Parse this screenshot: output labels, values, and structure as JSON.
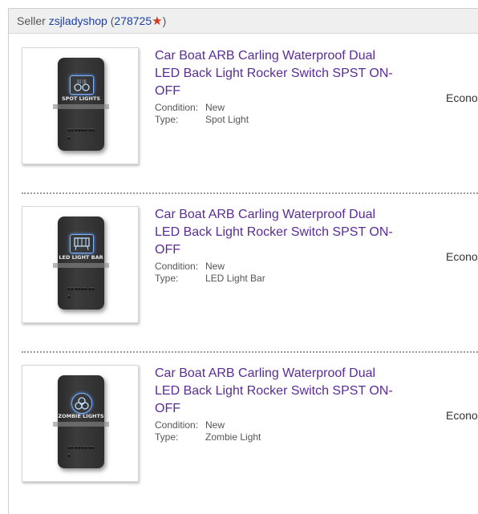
{
  "seller": {
    "prefix": "Seller",
    "name": "zsjladyshop",
    "feedback_open": "(",
    "feedback_score": "278725",
    "star": "★",
    "feedback_close": ")"
  },
  "items": [
    {
      "title": "Car Boat ARB Carling Waterproof Dual LED Back Light Rocker Switch SPST ON-OFF",
      "condition_label": "Condition:",
      "condition_value": "New",
      "type_label": "Type:",
      "type_value": "Spot Light",
      "shipping": "Econo",
      "switch_text": "SPOT LIGHTS"
    },
    {
      "title": "Car Boat ARB Carling Waterproof Dual LED Back Light Rocker Switch SPST ON-OFF",
      "condition_label": "Condition:",
      "condition_value": "New",
      "type_label": "Type:",
      "type_value": "LED Light Bar",
      "shipping": "Econo",
      "switch_text": "LED LIGHT BAR"
    },
    {
      "title": "Car Boat ARB Carling Waterproof Dual LED Back Light Rocker Switch SPST ON-OFF",
      "condition_label": "Condition:",
      "condition_value": "New",
      "type_label": "Type:",
      "type_value": "Zombie Light",
      "shipping": "Econo",
      "switch_text": "ZOMBIE LIGHTS"
    }
  ],
  "colors": {
    "title_link": "#5a2c96",
    "seller_link": "#1a3fa8",
    "star": "#d23a1c",
    "switch_glow": "#7fb3ff"
  },
  "icons": [
    "spot-lights-icon",
    "light-bar-icon",
    "biohazard-icon",
    "star-icon"
  ]
}
